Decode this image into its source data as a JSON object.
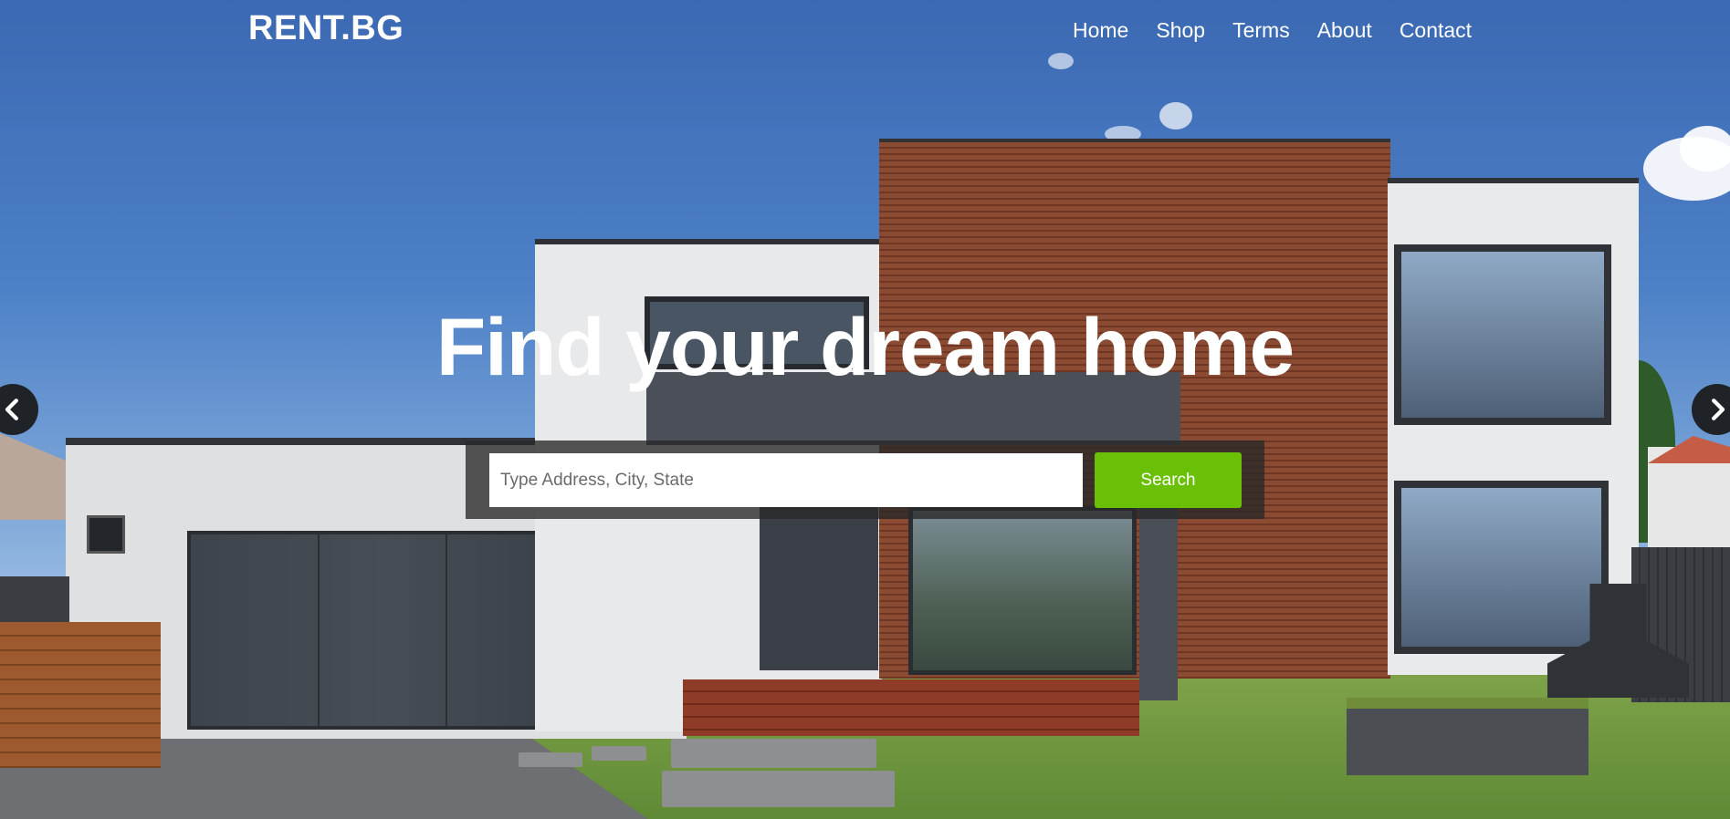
{
  "brand": {
    "logo_text": "RENT.BG"
  },
  "nav": {
    "items": [
      {
        "label": "Home"
      },
      {
        "label": "Shop"
      },
      {
        "label": "Terms"
      },
      {
        "label": "About"
      },
      {
        "label": "Contact"
      }
    ]
  },
  "hero": {
    "headline": "Find your dream home",
    "search": {
      "placeholder": "Type Address, City, State",
      "value": "",
      "button_label": "Search"
    },
    "carousel": {
      "prev_icon": "chevron-left-icon",
      "next_icon": "chevron-right-icon"
    }
  },
  "colors": {
    "accent": "#6abf07",
    "panel": "#282828",
    "text": "#ffffff"
  }
}
